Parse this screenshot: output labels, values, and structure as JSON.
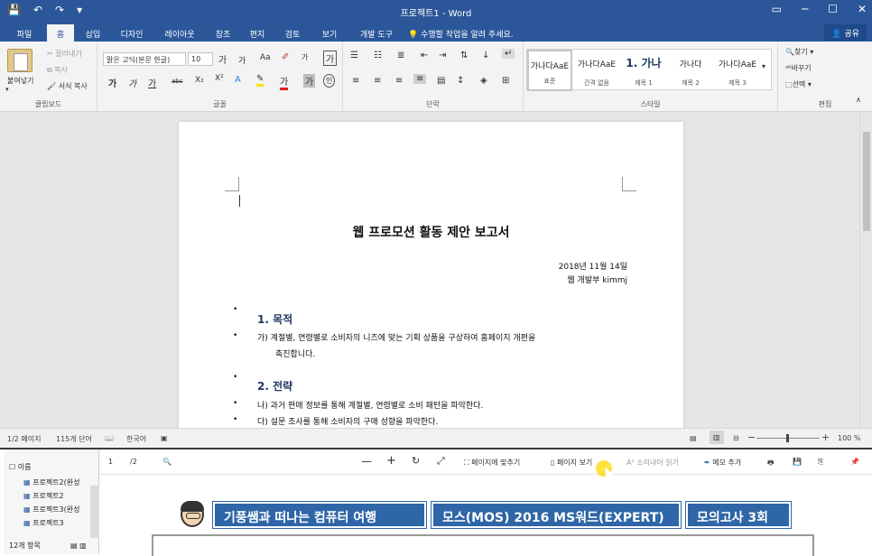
{
  "titlebar": {
    "title": "프로젝트1 - Word",
    "qat": [
      "💾",
      "↶",
      "↷",
      "▾"
    ],
    "window_buttons": [
      "▭",
      "─",
      "☐",
      "✕"
    ]
  },
  "tabs": {
    "items": [
      "파일",
      "홈",
      "삽입",
      "디자인",
      "레이아웃",
      "참조",
      "편지",
      "검토",
      "보기",
      "개발 도구"
    ],
    "active": "홈",
    "tell_me": "수행할 작업을 알려 주세요.",
    "share": "공유"
  },
  "clipboard": {
    "paste": "붙여넣기",
    "cut": "잘라내기",
    "copy": "복사",
    "format_painter": "서식 복사",
    "label": "클립보드"
  },
  "font": {
    "name": "맑은 고딕(본문 한글)",
    "size": "10",
    "grow": "가",
    "shrink": "가",
    "case": "Aa",
    "bold": "가",
    "italic": "가",
    "underline": "가",
    "strike": "abc",
    "subscript": "X₂",
    "superscript": "X²",
    "label": "글꼴"
  },
  "paragraph": {
    "label": "단락"
  },
  "styles": {
    "items": [
      {
        "sample": "가나다AaE",
        "name": "표준"
      },
      {
        "sample": "가나다AaE",
        "name": "간격 없음"
      },
      {
        "sample": "1. 가나",
        "name": "제목 1"
      },
      {
        "sample": "가나다",
        "name": "제목 2"
      },
      {
        "sample": "가나다AaE",
        "name": "제목 3"
      }
    ],
    "label": "스타일"
  },
  "editing": {
    "find": "찾기",
    "replace": "바꾸기",
    "select": "선택",
    "label": "편집"
  },
  "document": {
    "title": "웹 프로모션 활동 제안 보고서",
    "date": "2018년 11월 14일",
    "author": "웹 개발부 kimmj",
    "sections": [
      {
        "heading": "1. 목적",
        "items": [
          {
            "marker": "가)",
            "text": "계절별, 연령별로 소비자의 니즈에 맞는 기획 상품을 구상하여 홈페이지 개편을",
            "cont": "촉진합니다."
          }
        ]
      },
      {
        "heading": "2. 전략",
        "items": [
          {
            "marker": "나)",
            "text": "과거 판매 정보를 통해 계절별, 연령별로 소비 패턴을 파악한다."
          },
          {
            "marker": "다)",
            "text": "설문 조사를 통해 소비자의 구매 성향을 파악한다."
          }
        ]
      }
    ]
  },
  "status": {
    "page": "1/2 페이지",
    "words": "115개 단어",
    "language": "한국어",
    "zoom": "100 %",
    "zoom_level": 1.0
  },
  "viewer": {
    "sidebar": {
      "header": "이름",
      "files": [
        "프로젝트2(완성",
        "프로젝트2",
        "프로젝트3(완성",
        "프로젝트3"
      ],
      "count": "12개 항목"
    },
    "toolbar": {
      "page_current": "1",
      "page_total": "/2",
      "fit_page": "페이지에 맞추기",
      "page_view": "페이지 보기",
      "read_aloud": "소리내어 읽기",
      "add_note": "메모 추가"
    },
    "banners": [
      "기풍쌤과 떠나는 컴퓨터 여행",
      "모스(MOS) 2016 MS워드(EXPERT)",
      "모의고사 3회"
    ]
  }
}
